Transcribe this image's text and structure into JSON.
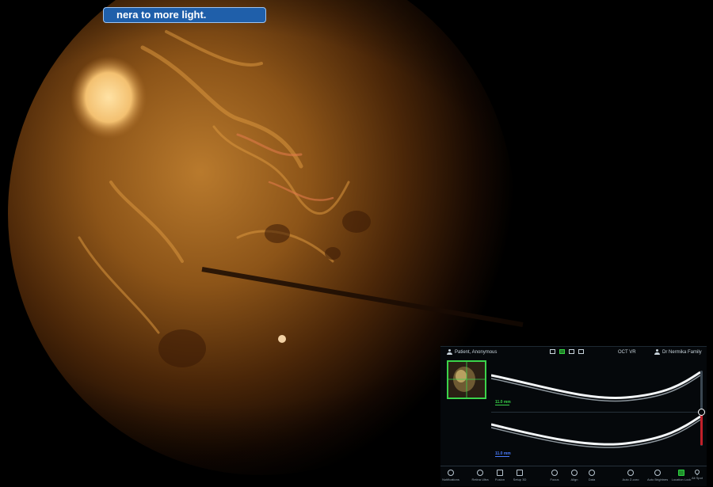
{
  "banner": {
    "text": "nera to more light."
  },
  "oct_panel": {
    "header": {
      "patient": "Patient, Anonymous",
      "mode": "OCT VR",
      "doctor": "Dr Nermika Family"
    },
    "scans": [
      {
        "depth_label": "11.0 mm",
        "color": "#38d248"
      },
      {
        "depth_label": "11.0 mm",
        "color": "#4a7dff"
      }
    ],
    "toolbar": [
      {
        "icon": "info-icon",
        "label": "Notifications"
      },
      {
        "icon": "eye-icon",
        "label": "Retina Ultra"
      },
      {
        "icon": "layers-icon",
        "label": "Fusion"
      },
      {
        "icon": "frame-icon",
        "label": "Setup 3D"
      },
      {
        "icon": "focus-icon",
        "label": "Focus"
      },
      {
        "icon": "target-icon",
        "label": "Align"
      },
      {
        "icon": "settings-icon",
        "label": "Data"
      },
      {
        "icon": "reset-icon",
        "label": "Auto Z-coro"
      },
      {
        "icon": "highlight-icon",
        "label": "Auto Brightness"
      },
      {
        "icon": "lock-icon",
        "label": "Location Lock"
      },
      {
        "icon": "pin-icon",
        "label": "Alt Spot"
      }
    ]
  },
  "colors": {
    "banner_bg": "#1f5faa",
    "active_green": "#38d248",
    "scan_blue": "#4a7dff",
    "slider_red": "#c2202a"
  }
}
